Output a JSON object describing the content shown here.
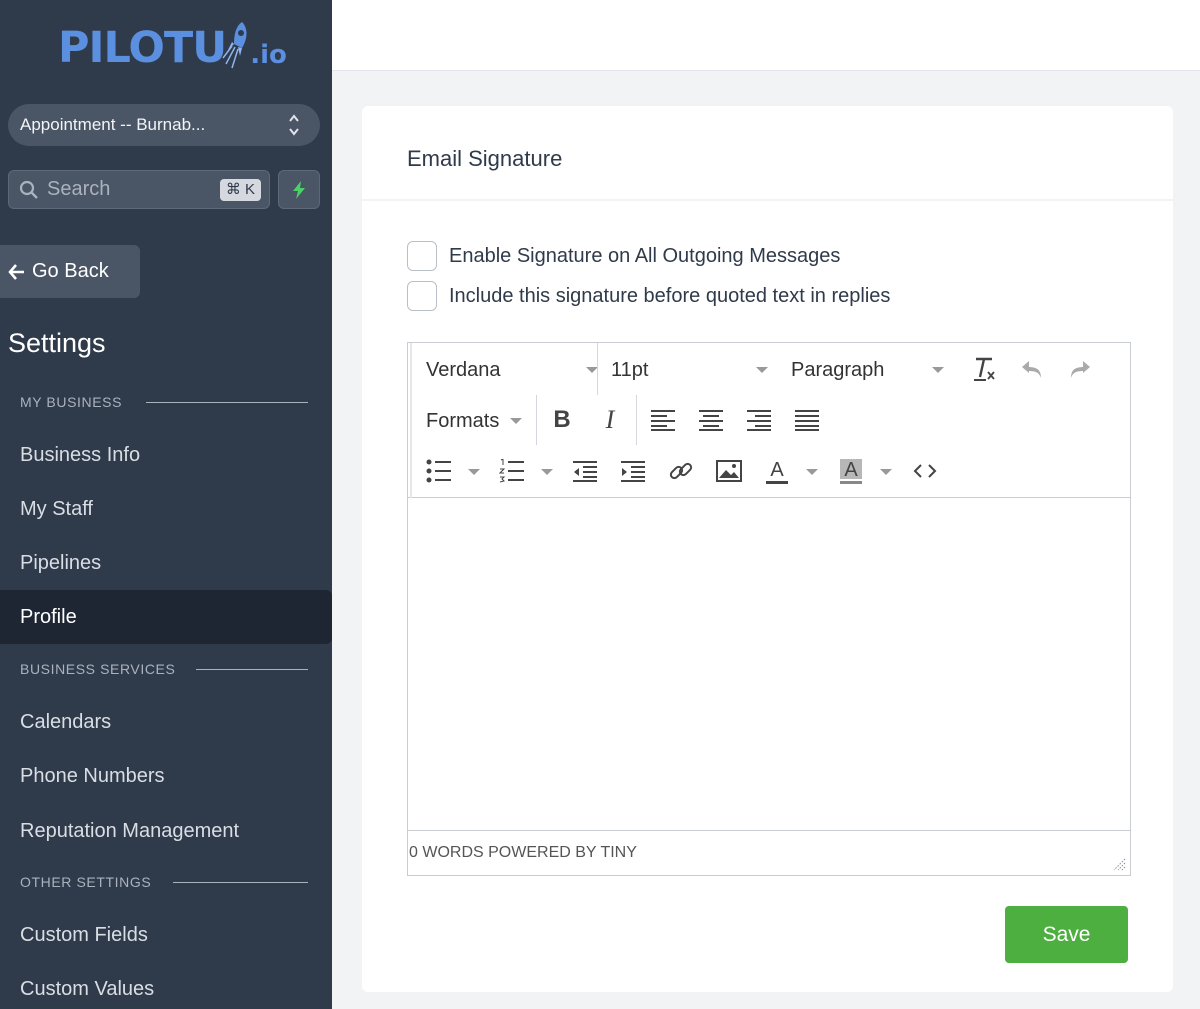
{
  "brand": {
    "logo_main": "PILOTU",
    "logo_suffix": ".io",
    "accent": "#5b8fe0"
  },
  "sidebar": {
    "location": "Appointment -- Burnab...",
    "search": {
      "placeholder": "Search",
      "shortcut": "⌘ K"
    },
    "go_back": "Go Back",
    "title": "Settings",
    "sections": [
      {
        "label": "MY BUSINESS",
        "items": [
          "Business Info",
          "My Staff",
          "Pipelines",
          "Profile"
        ]
      },
      {
        "label": "BUSINESS SERVICES",
        "items": [
          "Calendars",
          "Phone Numbers",
          "Reputation Management"
        ]
      },
      {
        "label": "OTHER SETTINGS",
        "items": [
          "Custom Fields",
          "Custom Values"
        ]
      }
    ],
    "active_item": "Profile"
  },
  "main": {
    "card_title": "Email Signature",
    "checkboxes": [
      {
        "label": "Enable Signature on All Outgoing Messages",
        "checked": false
      },
      {
        "label": "Include this signature before quoted text in replies",
        "checked": false
      }
    ],
    "editor": {
      "font_family": "Verdana",
      "font_size": "11pt",
      "block_format": "Paragraph",
      "formats_label": "Formats",
      "bold_glyph": "B",
      "italic_glyph": "I",
      "content": "",
      "status": "0 WORDS POWERED BY TINY"
    },
    "save_label": "Save",
    "save_color": "#4caf3f"
  }
}
